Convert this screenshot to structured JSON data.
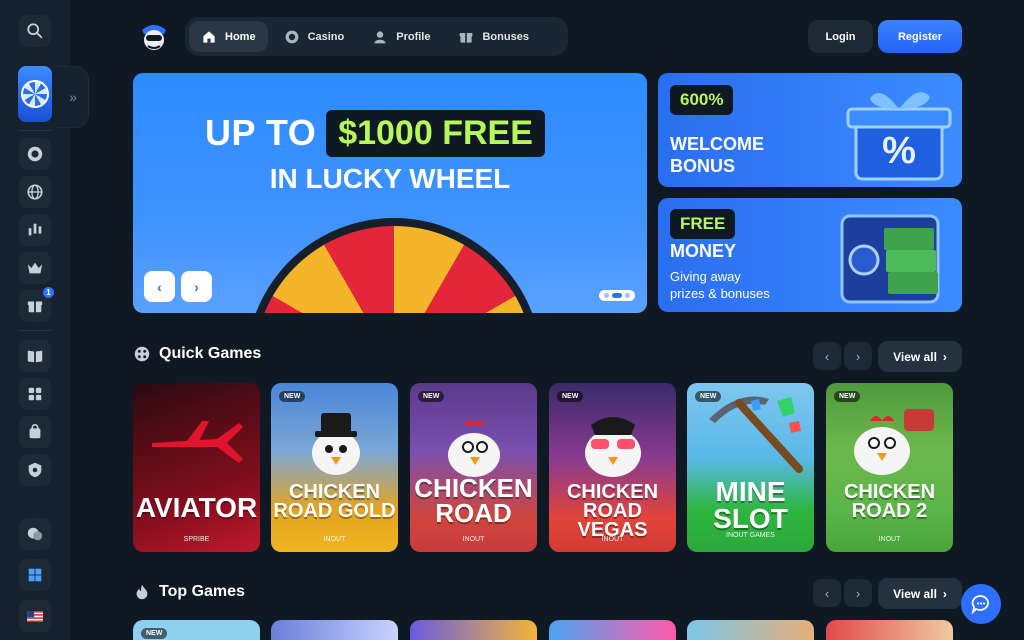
{
  "nav": {
    "items": [
      {
        "label": "Home",
        "icon": "home-icon",
        "active": true
      },
      {
        "label": "Casino",
        "icon": "casino-chip-icon",
        "active": false
      },
      {
        "label": "Profile",
        "icon": "profile-icon",
        "active": false
      },
      {
        "label": "Bonuses",
        "icon": "gift-icon",
        "active": false
      }
    ]
  },
  "auth": {
    "login_label": "Login",
    "register_label": "Register"
  },
  "sidebar": {
    "expand_glyph": "»",
    "bonus_badge": "1",
    "icons": [
      "search-icon",
      "lucky-wheel-thumb",
      "casino-chip-icon",
      "globe-icon",
      "chart-icon",
      "crown-icon",
      "gift-icon",
      "book-icon",
      "games-icon",
      "bag-icon",
      "shield-icon",
      "support-icon",
      "windows-icon",
      "us-flag-icon"
    ]
  },
  "hero": {
    "line1_prefix": "UP TO",
    "amount": "$1000 FREE",
    "line2": "IN LUCKY WHEEL",
    "prev_glyph": "‹",
    "next_glyph": "›"
  },
  "promos": [
    {
      "chip": "600%",
      "title_lines": [
        "WELCOME",
        "BONUS"
      ]
    },
    {
      "chip": "FREE",
      "title": "MONEY",
      "subtitle_lines": [
        "Giving away",
        "prizes & bonuses"
      ]
    }
  ],
  "quick_games": {
    "title": "Quick Games",
    "view_all": "View all",
    "games": [
      {
        "name_lines": [
          "AVIATOR"
        ],
        "provider": "SPRIBE",
        "new": false
      },
      {
        "name_lines": [
          "CHICKEN",
          "ROAD GOLD"
        ],
        "provider": "INOUT",
        "new": true
      },
      {
        "name_lines": [
          "CHICKEN",
          "ROAD"
        ],
        "provider": "INOUT",
        "new": true
      },
      {
        "name_lines": [
          "CHICKEN",
          "ROAD VEGAS"
        ],
        "provider": "INOUT",
        "new": true
      },
      {
        "name_lines": [
          "MINE",
          "SLOT"
        ],
        "provider": "INOUT GAMES",
        "new": true
      },
      {
        "name_lines": [
          "CHICKEN",
          "ROAD 2"
        ],
        "provider": "INOUT",
        "new": true
      }
    ]
  },
  "top_games": {
    "title": "Top Games",
    "view_all": "View all",
    "first_card_new": "NEW"
  },
  "new_tag": "NEW",
  "colors": {
    "accent": "#2f6fff",
    "lime": "#b6f75a",
    "bg": "#0f1923"
  }
}
